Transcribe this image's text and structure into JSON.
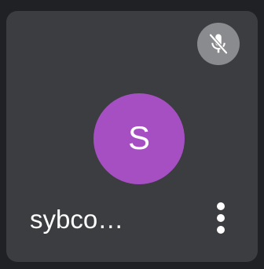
{
  "participant": {
    "name": "sybco…",
    "initial": "S",
    "avatar_color": "#a64fc3"
  },
  "mic": {
    "state": "muted",
    "icon": "mic-off-icon"
  },
  "more_options": {
    "icon": "more-vertical-icon"
  },
  "colors": {
    "tile_background": "#3c3d40",
    "mic_badge_background": "#8a8b8e"
  }
}
